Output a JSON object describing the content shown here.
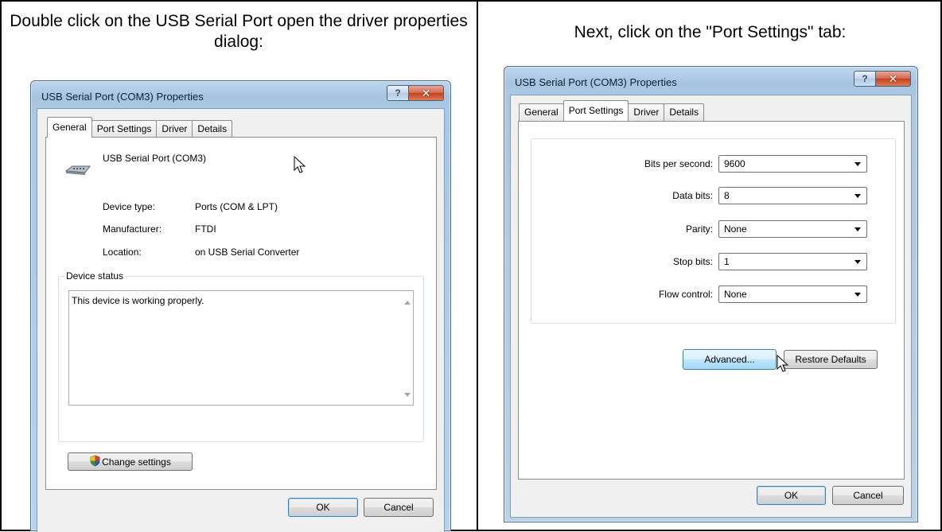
{
  "left_caption": "Double click on the USB Serial Port open the driver properties dialog:",
  "right_caption": "Next, click on the \"Port Settings\" tab:",
  "left_dialog": {
    "title": "USB Serial Port (COM3) Properties",
    "help_button": "?",
    "close_button": "✕",
    "tabs": [
      "General",
      "Port Settings",
      "Driver",
      "Details"
    ],
    "active_tab": "General",
    "device_name": "USB Serial Port (COM3)",
    "properties": [
      {
        "label": "Device type:",
        "value": "Ports (COM & LPT)"
      },
      {
        "label": "Manufacturer:",
        "value": "FTDI"
      },
      {
        "label": "Location:",
        "value": "on USB Serial Converter"
      }
    ],
    "status_group_title": "Device status",
    "status_text": "This device is working properly.",
    "change_settings_label": "Change settings",
    "ok_label": "OK",
    "cancel_label": "Cancel"
  },
  "right_dialog": {
    "title": "USB Serial Port (COM3) Properties",
    "help_button": "?",
    "close_button": "✕",
    "tabs": [
      "General",
      "Port Settings",
      "Driver",
      "Details"
    ],
    "active_tab": "Port Settings",
    "fields": [
      {
        "label": "Bits per second:",
        "value": "9600"
      },
      {
        "label": "Data bits:",
        "value": "8"
      },
      {
        "label": "Parity:",
        "value": "None"
      },
      {
        "label": "Stop bits:",
        "value": "1"
      },
      {
        "label": "Flow control:",
        "value": "None"
      }
    ],
    "advanced_label": "Advanced...",
    "restore_label": "Restore Defaults",
    "ok_label": "OK",
    "cancel_label": "Cancel"
  },
  "icons": {
    "serial_port": "serial-port-icon",
    "shield": "uac-shield-icon",
    "cursor": "mouse-pointer-icon"
  }
}
